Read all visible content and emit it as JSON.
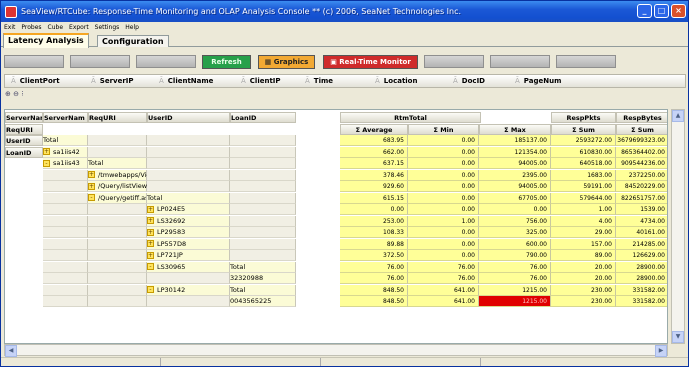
{
  "window": {
    "title": "SeaView/RTCube:  Response-Time Monitoring and OLAP Analysis Console  **  (c) 2006, SeaNet Technologies Inc."
  },
  "menu": [
    "Exit",
    "Probes",
    "Cube",
    "Export",
    "Settings",
    "Help"
  ],
  "tabs": [
    {
      "label": "Latency Analysis",
      "active": true
    },
    {
      "label": "Configuration",
      "active": false
    }
  ],
  "toolbar": {
    "refresh": "Refresh",
    "graphics": "Graphics",
    "realtime": "Real-Time Monitor"
  },
  "fields": [
    "ClientPort",
    "ServerIP",
    "ClientName",
    "ClientIP",
    "Time",
    "Location",
    "DocID",
    "PageNum"
  ],
  "row_fields": [
    "ServerName",
    "ReqURI",
    "UserID",
    "LoanID"
  ],
  "grid_row_headers": [
    "ServerNam",
    "ReqURI",
    "UserID",
    "LoanID"
  ],
  "measures": [
    {
      "name": "RtmTotal",
      "aggs": [
        "Σ Average",
        "Σ Min",
        "Σ Max"
      ]
    },
    {
      "name": "RespPkts",
      "aggs": [
        "Σ Sum"
      ]
    },
    {
      "name": "RespBytes",
      "aggs": [
        "Σ Sum"
      ]
    }
  ],
  "rows": [
    {
      "cells": [
        "Total",
        "",
        "",
        ""
      ],
      "exp": [
        null,
        null,
        null,
        null
      ],
      "values": [
        "683.95",
        "0.00",
        "185137.00",
        "2593272.00",
        "3679699323.00"
      ]
    },
    {
      "cells": [
        "sa1iis42",
        "",
        "",
        ""
      ],
      "exp": [
        "+",
        null,
        null,
        null
      ],
      "values": [
        "662.00",
        "0.00",
        "121354.00",
        "610830.00",
        "865364402.00"
      ]
    },
    {
      "cells": [
        "sa1iis43",
        "Total",
        "",
        ""
      ],
      "exp": [
        "-",
        null,
        null,
        null
      ],
      "values": [
        "637.15",
        "0.00",
        "94005.00",
        "640518.00",
        "909544236.00"
      ]
    },
    {
      "cells": [
        "",
        "/tmwebapps/Viewer/getiff.asp",
        "",
        ""
      ],
      "exp": [
        null,
        "+",
        null,
        null
      ],
      "values": [
        "378.46",
        "0.00",
        "2395.00",
        "1683.00",
        "2372250.00"
      ]
    },
    {
      "cells": [
        "",
        "/Query/listViewResults.asp",
        "",
        ""
      ],
      "exp": [
        null,
        "+",
        null,
        null
      ],
      "values": [
        "929.60",
        "0.00",
        "94005.00",
        "59191.00",
        "84520229.00"
      ]
    },
    {
      "cells": [
        "",
        "/Query/getiff.asp",
        "Total",
        ""
      ],
      "exp": [
        null,
        "-",
        null,
        null
      ],
      "values": [
        "615.15",
        "0.00",
        "67705.00",
        "579644.00",
        "822651757.00"
      ]
    },
    {
      "cells": [
        "",
        "",
        "LP024E5",
        ""
      ],
      "exp": [
        null,
        null,
        "+",
        null
      ],
      "values": [
        "0.00",
        "0.00",
        "0.00",
        "1.00",
        "1539.00"
      ]
    },
    {
      "cells": [
        "",
        "",
        "LS32692",
        ""
      ],
      "exp": [
        null,
        null,
        "+",
        null
      ],
      "values": [
        "253.00",
        "1.00",
        "756.00",
        "4.00",
        "4734.00"
      ]
    },
    {
      "cells": [
        "",
        "",
        "LP29583",
        ""
      ],
      "exp": [
        null,
        null,
        "+",
        null
      ],
      "values": [
        "108.33",
        "0.00",
        "325.00",
        "29.00",
        "40161.00"
      ]
    },
    {
      "cells": [
        "",
        "",
        "LP557D8",
        ""
      ],
      "exp": [
        null,
        null,
        "+",
        null
      ],
      "values": [
        "89.88",
        "0.00",
        "600.00",
        "157.00",
        "214285.00"
      ]
    },
    {
      "cells": [
        "",
        "",
        "LP721JP",
        ""
      ],
      "exp": [
        null,
        null,
        "+",
        null
      ],
      "values": [
        "372.50",
        "0.00",
        "790.00",
        "89.00",
        "126629.00"
      ]
    },
    {
      "cells": [
        "",
        "",
        "LS30965",
        "Total"
      ],
      "exp": [
        null,
        null,
        "-",
        null
      ],
      "values": [
        "76.00",
        "76.00",
        "76.00",
        "20.00",
        "28900.00"
      ]
    },
    {
      "cells": [
        "",
        "",
        "",
        "32320988"
      ],
      "exp": [
        null,
        null,
        null,
        null
      ],
      "values": [
        "76.00",
        "76.00",
        "76.00",
        "20.00",
        "28900.00"
      ]
    },
    {
      "cells": [
        "",
        "",
        "LP30142",
        "Total"
      ],
      "exp": [
        null,
        null,
        "-",
        null
      ],
      "values": [
        "848.50",
        "641.00",
        "1215.00",
        "230.00",
        "331582.00"
      ]
    },
    {
      "cells": [
        "",
        "",
        "",
        "0043565225"
      ],
      "exp": [
        null,
        null,
        null,
        null
      ],
      "values": [
        "848.50",
        "641.00",
        "1215.00",
        "230.00",
        "331582.00"
      ],
      "alert_col": 2
    }
  ],
  "colors": {
    "value_bg": "#ffff98",
    "alert": "#e00000",
    "tab_accent": "#f5a623"
  }
}
